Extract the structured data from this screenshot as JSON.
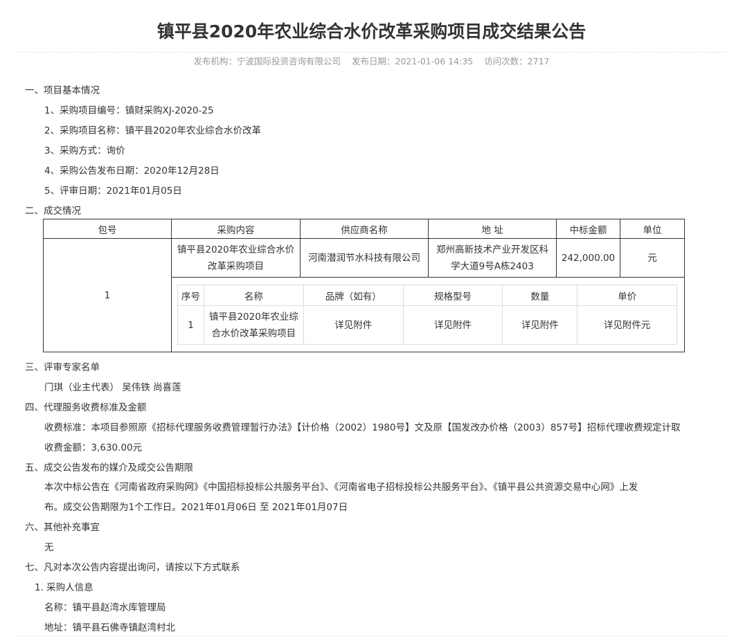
{
  "title": "镇平县2020年农业综合水价改革采购项目成交结果公告",
  "meta": {
    "publisher": "发布机构：宁波国际投资咨询有限公司",
    "date": "发布日期：2021-01-06 14:35",
    "visits": "访问次数：2717"
  },
  "sections": {
    "s1": "一、项目基本情况",
    "s1_items": [
      "1、采购项目编号：镇财采购XJ-2020-25",
      "2、采购项目名称：镇平县2020年农业综合水价改革",
      "3、采购方式：询价",
      "4、采购公告发布日期：2020年12月28日",
      "5、评审日期：2021年01月05日"
    ],
    "s2": "二、成交情况",
    "s3": "三、评审专家名单",
    "s3_text": "门琪（业主代表） 吴伟铁 尚喜莲",
    "s4": "四、代理服务收费标准及金额",
    "s4_std": "收费标准：本项目参照原《招标代理服务收费管理暂行办法》【计价格（2002）1980号】文及原【国发改办价格（2003）857号】招标代理收费规定计取",
    "s4_amt": "收费金额：3,630.00元",
    "s5": "五、成交公告发布的媒介及成交公告期限",
    "s5_l1": "本次中标公告在《河南省政府采购网》《中国招标投标公共服务平台》、《河南省电子招标投标公共服务平台》、《镇平县公共资源交易中心网》上发",
    "s5_l2": "布。成交公告期限为1个工作日。2021年01月06日 至 2021年01月07日",
    "s6": "六、其他补充事宜",
    "s6_text": "无",
    "s7": "七、凡对本次公告内容提出询问，请按以下方式联系",
    "s7_sub": "1. 采购人信息",
    "s7_name": "名称：镇平县赵湾水库管理局",
    "s7_addr": "地址：镇平县石佛寺镇赵湾村北"
  },
  "table": {
    "headers": [
      "包号",
      "采购内容",
      "供应商名称",
      "地 址",
      "中标金额",
      "单位"
    ],
    "row": {
      "pkg": "1",
      "content_l1": "镇平县2020年农业综合水价",
      "content_l2": "改革采购项目",
      "supplier": "河南潜润节水科技有限公司",
      "addr_l1": "郑州高新技术产业开发区科",
      "addr_l2": "学大道9号A栋2403",
      "amount": "242,000.00",
      "unit": "元"
    },
    "sub_headers": [
      "序号",
      "名称",
      "品牌（如有）",
      "规格型号",
      "数量",
      "单价"
    ],
    "sub_row": {
      "no": "1",
      "name_l1": "镇平县2020年农业综",
      "name_l2": "合水价改革采购项目",
      "brand": "详见附件",
      "spec": "详见附件",
      "qty": "详见附件",
      "price": "详见附件元"
    }
  }
}
